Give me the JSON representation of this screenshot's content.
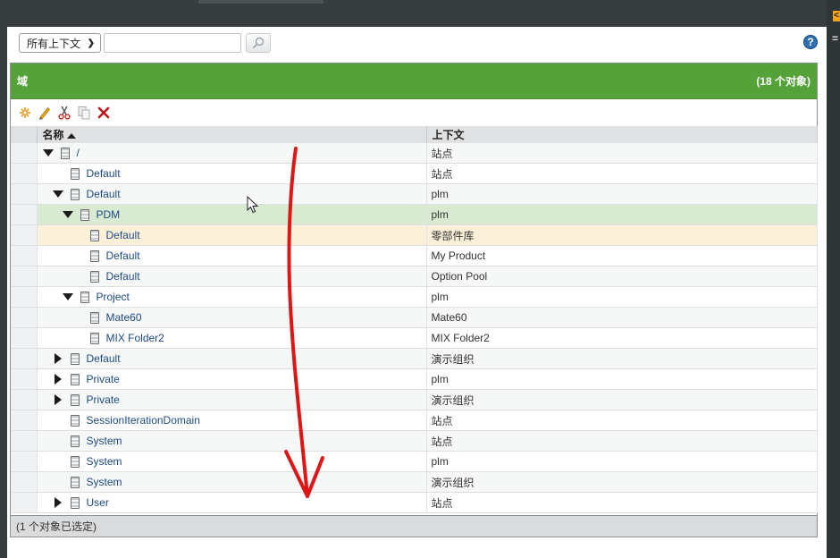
{
  "toolbar": {
    "context_select": "所有上下文",
    "search_value": "",
    "help_label": "?"
  },
  "panel": {
    "title": "域",
    "count": "(18 个对象)",
    "tools": [
      "new-icon",
      "edit-icon",
      "cut-icon",
      "copy-icon",
      "delete-icon"
    ],
    "columns": {
      "name": "名称",
      "sort_indicator": "^",
      "context": "上下文"
    },
    "rows": [
      {
        "name": "/",
        "context": "站点",
        "depth": 0,
        "toggle": "expanded"
      },
      {
        "name": "Default",
        "context": "站点",
        "depth": 1,
        "toggle": "none"
      },
      {
        "name": "Default",
        "context": "plm",
        "depth": 1,
        "toggle": "expanded"
      },
      {
        "name": "PDM",
        "context": "plm",
        "depth": 2,
        "toggle": "expanded",
        "state": "highlighted"
      },
      {
        "name": "Default",
        "context": "零部件库",
        "depth": 3,
        "toggle": "none",
        "state": "selected"
      },
      {
        "name": "Default",
        "context": "My Product",
        "depth": 3,
        "toggle": "none"
      },
      {
        "name": "Default",
        "context": "Option Pool",
        "depth": 3,
        "toggle": "none"
      },
      {
        "name": "Project",
        "context": "plm",
        "depth": 2,
        "toggle": "expanded"
      },
      {
        "name": "Mate60",
        "context": "Mate60",
        "depth": 3,
        "toggle": "none"
      },
      {
        "name": "MIX Folder2",
        "context": "MIX Folder2",
        "depth": 3,
        "toggle": "none"
      },
      {
        "name": "Default",
        "context": "演示组织",
        "depth": 1,
        "toggle": "collapsed"
      },
      {
        "name": "Private",
        "context": "plm",
        "depth": 1,
        "toggle": "collapsed"
      },
      {
        "name": "Private",
        "context": "演示组织",
        "depth": 1,
        "toggle": "collapsed"
      },
      {
        "name": "SessionIterationDomain",
        "context": "站点",
        "depth": 1,
        "toggle": "none"
      },
      {
        "name": "System",
        "context": "站点",
        "depth": 1,
        "toggle": "none"
      },
      {
        "name": "System",
        "context": "plm",
        "depth": 1,
        "toggle": "none"
      },
      {
        "name": "System",
        "context": "演示组织",
        "depth": 1,
        "toggle": "none"
      },
      {
        "name": "User",
        "context": "站点",
        "depth": 1,
        "toggle": "collapsed"
      }
    ],
    "status": "(1 个对象已选定)"
  },
  "colors": {
    "header_green": "#56a23a",
    "highlight_row": "#d8ebd2",
    "selected_row": "#fdf0d8",
    "annotation_red": "#e01616"
  }
}
